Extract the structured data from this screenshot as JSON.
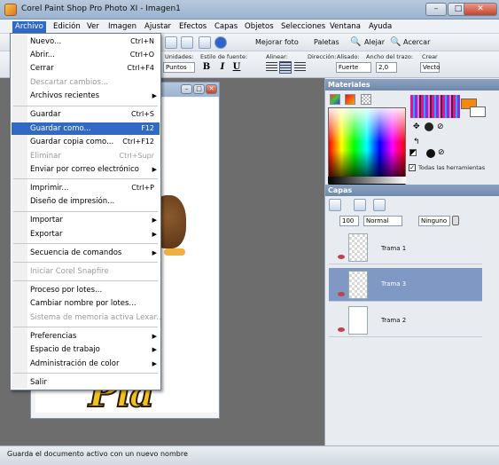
{
  "window": {
    "title": "Corel Paint Shop Pro Photo XI - Imagen1",
    "minimize": "–",
    "maximize": "□",
    "close": "✕"
  },
  "menubar": [
    "Archivo",
    "Edición",
    "Ver",
    "Imagen",
    "Ajustar",
    "Efectos",
    "Capas",
    "Objetos",
    "Selecciones",
    "Ventana",
    "Ayuda"
  ],
  "toolbar": {
    "enhance_label": "Mejorar foto",
    "palettes_label": "Paletas",
    "zoom_out_label": "Alejar",
    "zoom_in_label": "Acercar"
  },
  "text_options": {
    "units_label": "Unidades:",
    "units_value": "Puntos",
    "style_label": "Estilo de fuente:",
    "align_label": "Alinear:",
    "direction_label": "Dirección:",
    "antialias_label": "Alisado:",
    "antialias_value": "Fuerte",
    "stroke_label": "Ancho del trazo:",
    "stroke_value": "2,0",
    "create_label": "Crear",
    "create_value": "Vecto",
    "bold": "B",
    "italic": "I",
    "underline": "U"
  },
  "file_menu": [
    {
      "label": "Nuevo...",
      "shortcut": "Ctrl+N",
      "enabled": true
    },
    {
      "label": "Abrir...",
      "shortcut": "Ctrl+O",
      "enabled": true
    },
    {
      "label": "Cerrar",
      "shortcut": "Ctrl+F4",
      "enabled": true
    },
    {
      "label": "Descartar cambios...",
      "shortcut": "",
      "enabled": false
    },
    {
      "label": "Archivos recientes",
      "shortcut": "",
      "enabled": true,
      "submenu": true
    },
    {
      "label": "Guardar",
      "shortcut": "Ctrl+S",
      "enabled": true
    },
    {
      "label": "Guardar como...",
      "shortcut": "F12",
      "enabled": true,
      "selected": true
    },
    {
      "label": "Guardar copia como...",
      "shortcut": "Ctrl+F12",
      "enabled": true
    },
    {
      "label": "Eliminar",
      "shortcut": "Ctrl+Supr",
      "enabled": false
    },
    {
      "label": "Enviar por correo electrónico",
      "shortcut": "",
      "enabled": true,
      "submenu": true
    },
    {
      "label": "Imprimir...",
      "shortcut": "Ctrl+P",
      "enabled": true
    },
    {
      "label": "Diseño de impresión...",
      "shortcut": "",
      "enabled": true
    },
    {
      "label": "Importar",
      "shortcut": "",
      "enabled": true,
      "submenu": true
    },
    {
      "label": "Exportar",
      "shortcut": "",
      "enabled": true,
      "submenu": true
    },
    {
      "label": "Secuencia de comandos",
      "shortcut": "",
      "enabled": true,
      "submenu": true
    },
    {
      "label": "Iniciar Corel Snapfire",
      "shortcut": "",
      "enabled": false
    },
    {
      "label": "Proceso por lotes...",
      "shortcut": "",
      "enabled": true
    },
    {
      "label": "Cambiar nombre por lotes...",
      "shortcut": "",
      "enabled": true
    },
    {
      "label": "Sistema de memoria activa Lexar...",
      "shortcut": "",
      "enabled": false
    },
    {
      "label": "Preferencias",
      "shortcut": "",
      "enabled": true,
      "submenu": true
    },
    {
      "label": "Espacio de trabajo",
      "shortcut": "",
      "enabled": true,
      "submenu": true
    },
    {
      "label": "Administración de color",
      "shortcut": "",
      "enabled": true,
      "submenu": true
    },
    {
      "label": "Salir",
      "shortcut": "",
      "enabled": true
    }
  ],
  "materials": {
    "title": "Materiales",
    "all_tools_label": "Todas las herramientas",
    "all_tools_checked": true
  },
  "layers": {
    "title": "Capas",
    "opacity": "100",
    "blend_mode": "Normal",
    "mask": "Ninguno",
    "items": [
      {
        "name": "Trama 1",
        "selected": false
      },
      {
        "name": "Trama 3",
        "selected": true
      },
      {
        "name": "Trama 2",
        "selected": false
      }
    ]
  },
  "canvas_text": "Pia",
  "status": "Guarda el documento activo con un nuevo nombre",
  "colors": {
    "accent": "#316ac5",
    "foreground": "#f18a0f",
    "background": "#ffffff"
  }
}
